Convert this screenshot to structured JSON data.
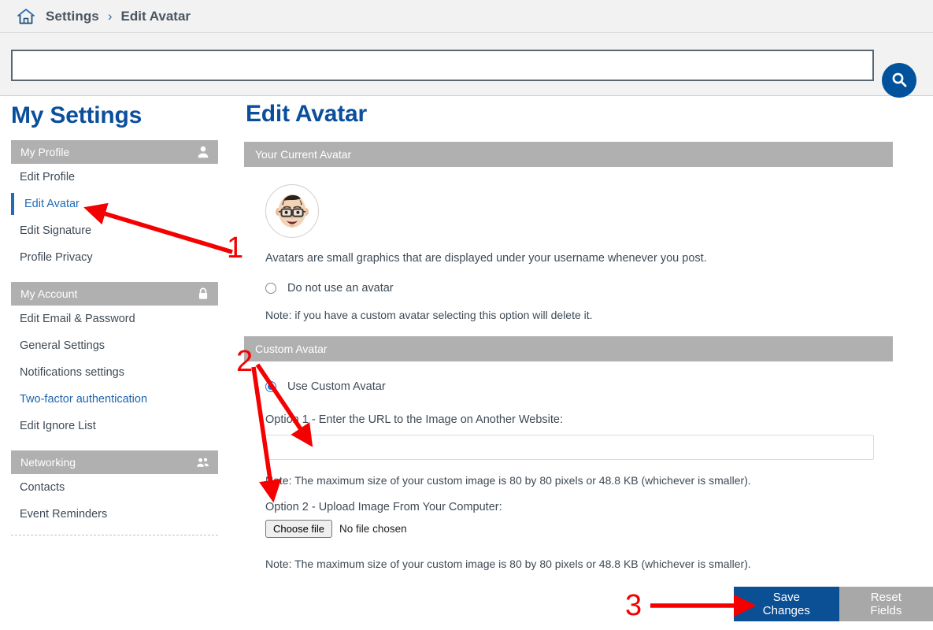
{
  "breadcrumb": {
    "home_icon": "home-icon",
    "items": [
      "Settings",
      "Edit Avatar"
    ],
    "separator": "›"
  },
  "search": {
    "value": "",
    "placeholder": "",
    "button_icon": "search-icon"
  },
  "sidebar": {
    "title": "My Settings",
    "groups": [
      {
        "label": "My Profile",
        "icon": "person-icon",
        "items": [
          {
            "label": "Edit Profile",
            "state": "normal"
          },
          {
            "label": "Edit Avatar",
            "state": "active"
          },
          {
            "label": "Edit Signature",
            "state": "normal"
          },
          {
            "label": "Profile Privacy",
            "state": "normal"
          }
        ]
      },
      {
        "label": "My Account",
        "icon": "lock-icon",
        "items": [
          {
            "label": "Edit Email & Password",
            "state": "normal"
          },
          {
            "label": "General Settings",
            "state": "normal"
          },
          {
            "label": "Notifications settings",
            "state": "normal"
          },
          {
            "label": "Two-factor authentication",
            "state": "link"
          },
          {
            "label": "Edit Ignore List",
            "state": "normal"
          }
        ]
      },
      {
        "label": "Networking",
        "icon": "people-group-icon",
        "items": [
          {
            "label": "Contacts",
            "state": "normal"
          },
          {
            "label": "Event Reminders",
            "state": "normal"
          }
        ]
      }
    ]
  },
  "main": {
    "title": "Edit Avatar",
    "current_avatar_section": {
      "header": "Your Current Avatar",
      "avatar_icon": "memoji-avatar",
      "caption": "Avatars are small graphics that are displayed under your username whenever you post.",
      "no_avatar_option": {
        "label": "Do not use an avatar",
        "checked": false
      },
      "no_avatar_note": "Note: if you have a custom avatar selecting this option will delete it."
    },
    "custom_avatar_section": {
      "header": "Custom Avatar",
      "use_custom_option": {
        "label": "Use Custom Avatar",
        "checked": true
      },
      "option1_label": "Option 1 - Enter the URL to the Image on Another Website:",
      "url_value": "",
      "url_placeholder": "",
      "option1_note": "Note: The maximum size of your custom image is 80 by 80 pixels or 48.8 KB (whichever is smaller).",
      "option2_label": "Option 2 - Upload Image From Your Computer:",
      "choose_file_button": "Choose file",
      "file_status": "No file chosen",
      "option2_note": "Note: The maximum size of your custom image is 80 by 80 pixels or 48.8 KB (whichever is smaller)."
    },
    "actions": {
      "save_label": "Save Changes",
      "reset_label": "Reset Fields"
    }
  },
  "annotations": {
    "markers": [
      "1",
      "2",
      "3"
    ],
    "color": "#f50000"
  },
  "colors": {
    "brand_blue": "#0b4f9c",
    "accent_blue": "#00529c",
    "save_button": "#0b4f94",
    "section_gray": "#b0b0b0",
    "reset_button": "#a8a8a8",
    "annotation_red": "#f50000"
  }
}
